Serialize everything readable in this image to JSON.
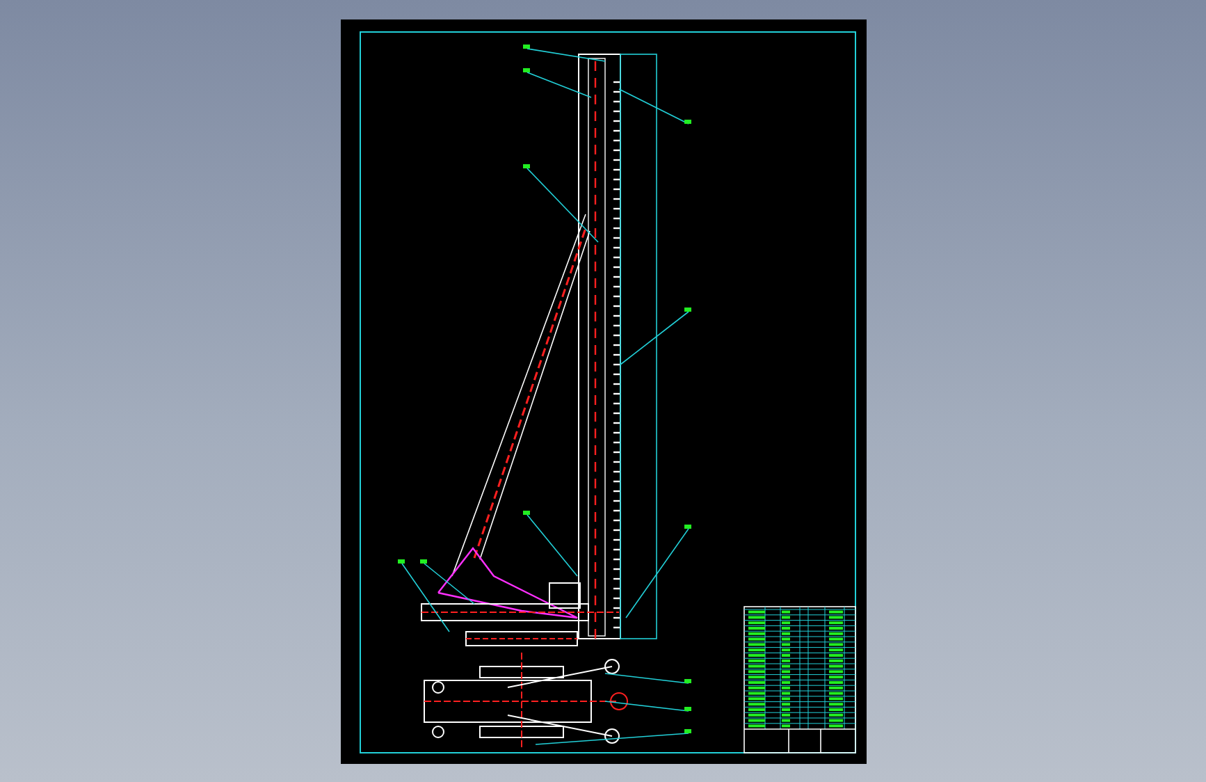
{
  "drawing": {
    "kind": "pile-driver"
  }
}
